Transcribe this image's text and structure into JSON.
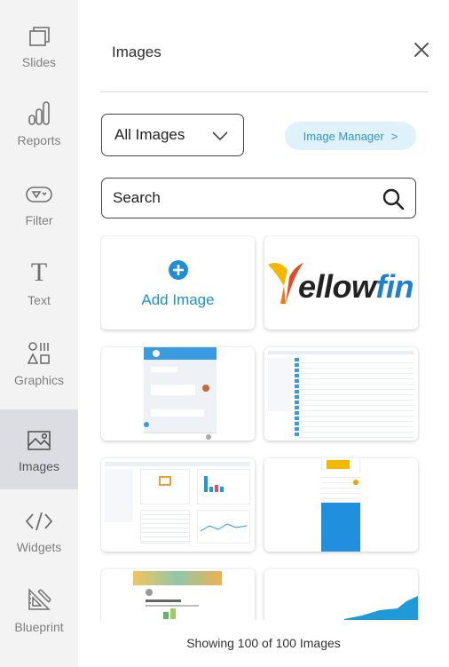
{
  "rail": {
    "items": [
      {
        "label": "Slides",
        "icon": "slides-icon"
      },
      {
        "label": "Reports",
        "icon": "reports-icon"
      },
      {
        "label": "Filter",
        "icon": "filter-icon"
      },
      {
        "label": "Text",
        "icon": "text-icon"
      },
      {
        "label": "Graphics",
        "icon": "graphics-icon"
      },
      {
        "label": "Images",
        "icon": "images-icon",
        "active": true
      },
      {
        "label": "Widgets",
        "icon": "widgets-icon"
      },
      {
        "label": "Blueprint",
        "icon": "blueprint-icon"
      }
    ]
  },
  "panel": {
    "title": "Images",
    "filter_select": {
      "value": "All Images"
    },
    "image_manager_label": "Image Manager",
    "image_manager_chevron": ">",
    "search": {
      "placeholder": "Search"
    },
    "add_image_label": "Add Image",
    "logo_text": "ellowfin",
    "footer": "Showing 100 of 100 Images"
  },
  "colors": {
    "accent": "#2f96d3",
    "rail_bg": "#f3f3f3",
    "rail_active": "#dcdde3",
    "pill_bg": "#dff2fb",
    "logo_yellow": "#f4b400",
    "logo_blue": "#1f7fcf"
  }
}
